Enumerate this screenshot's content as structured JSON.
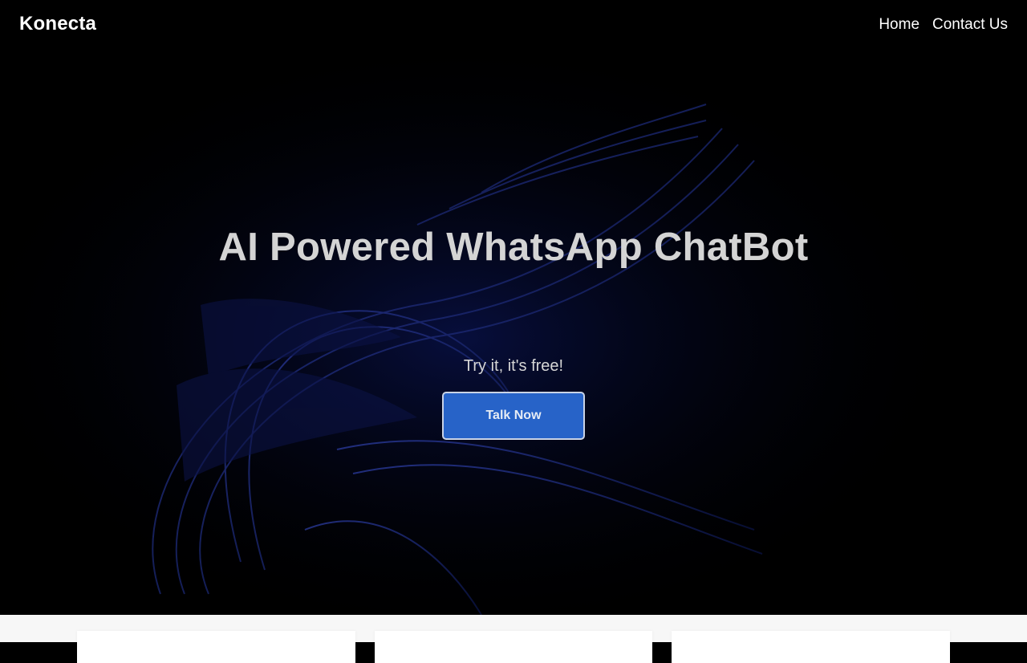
{
  "navbar": {
    "brand": "Konecta",
    "links": [
      {
        "label": "Home"
      },
      {
        "label": "Contact Us"
      }
    ]
  },
  "hero": {
    "title": "AI Powered WhatsApp ChatBot",
    "subtitle": "Try it, it's free!",
    "cta_label": "Talk Now"
  },
  "colors": {
    "background": "#000000",
    "accent": "#2763c8",
    "ribbon": "#1a2a7a",
    "lower_section": "#f7f7f7"
  }
}
